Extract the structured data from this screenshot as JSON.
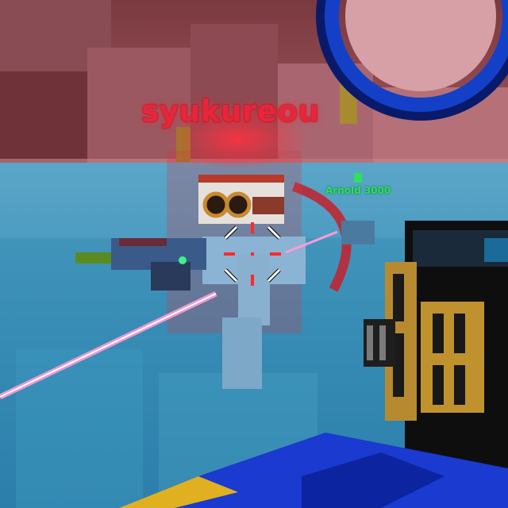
{
  "hud": {
    "target_player_name": "syukureou",
    "enemy_player_name": "Arnold 3000",
    "enemy_name_color": "#2fe05a",
    "target_name_color": "#e8253a",
    "crosshair_color": "#ff2a2a",
    "laser_color": "#ff9ad8"
  },
  "icons": {
    "crosshair": "crosshair-icon",
    "enemy_marker": "enemy-marker-icon"
  }
}
